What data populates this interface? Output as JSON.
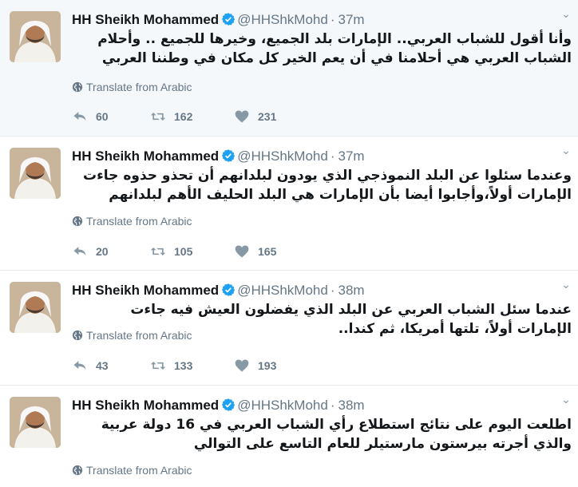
{
  "colors": {
    "text": "#14171a",
    "secondary": "#657786",
    "icon": "#8899a6",
    "verified": "#1da1f2",
    "highlight_bg": "#f5f8fa"
  },
  "icons": {
    "reply": "reply-icon",
    "retweet": "retweet-icon",
    "like": "heart-icon",
    "translate": "globe-icon",
    "menu": "chevron-down-icon"
  },
  "tweets": [
    {
      "name": "HH Sheikh Mohammed",
      "handle": "@HHShkMohd",
      "separator": "·",
      "time": "37m",
      "text": "وأنا أقول للشباب العربي.. الإمارات بلد الجميع، وخيرها للجميع .. وأحلام الشباب العربي هي أحلامنا في أن يعم الخير كل مكان في وطننا العربي",
      "translate": "Translate from Arabic",
      "replies": "60",
      "retweets": "162",
      "likes": "231"
    },
    {
      "name": "HH Sheikh Mohammed",
      "handle": "@HHShkMohd",
      "separator": "·",
      "time": "37m",
      "text": "وعندما سئلوا عن البلد النموذجي الذي يودون لبلدانهم أن تحذو حذوه جاءت الإمارات أولاً،وأجابوا أيضا بأن الإمارات هي البلد الحليف الأهم لبلدانهم",
      "translate": "Translate from Arabic",
      "replies": "20",
      "retweets": "105",
      "likes": "165"
    },
    {
      "name": "HH Sheikh Mohammed",
      "handle": "@HHShkMohd",
      "separator": "·",
      "time": "38m",
      "text": "عندما سئل الشباب العربي عن البلد الذي يفضلون العيش فيه جاءت الإمارات أولاً، تلتها أمريكا، ثم كندا..",
      "translate": "Translate from Arabic",
      "replies": "43",
      "retweets": "133",
      "likes": "193"
    },
    {
      "name": "HH Sheikh Mohammed",
      "handle": "@HHShkMohd",
      "separator": "·",
      "time": "38m",
      "text": "اطلعت اليوم على نتائج استطلاع رأي الشباب العربي في 16 دولة عربية والذي أجرته بيرستون مارستيلر للعام التاسع على التوالي",
      "translate": "Translate from Arabic"
    }
  ]
}
